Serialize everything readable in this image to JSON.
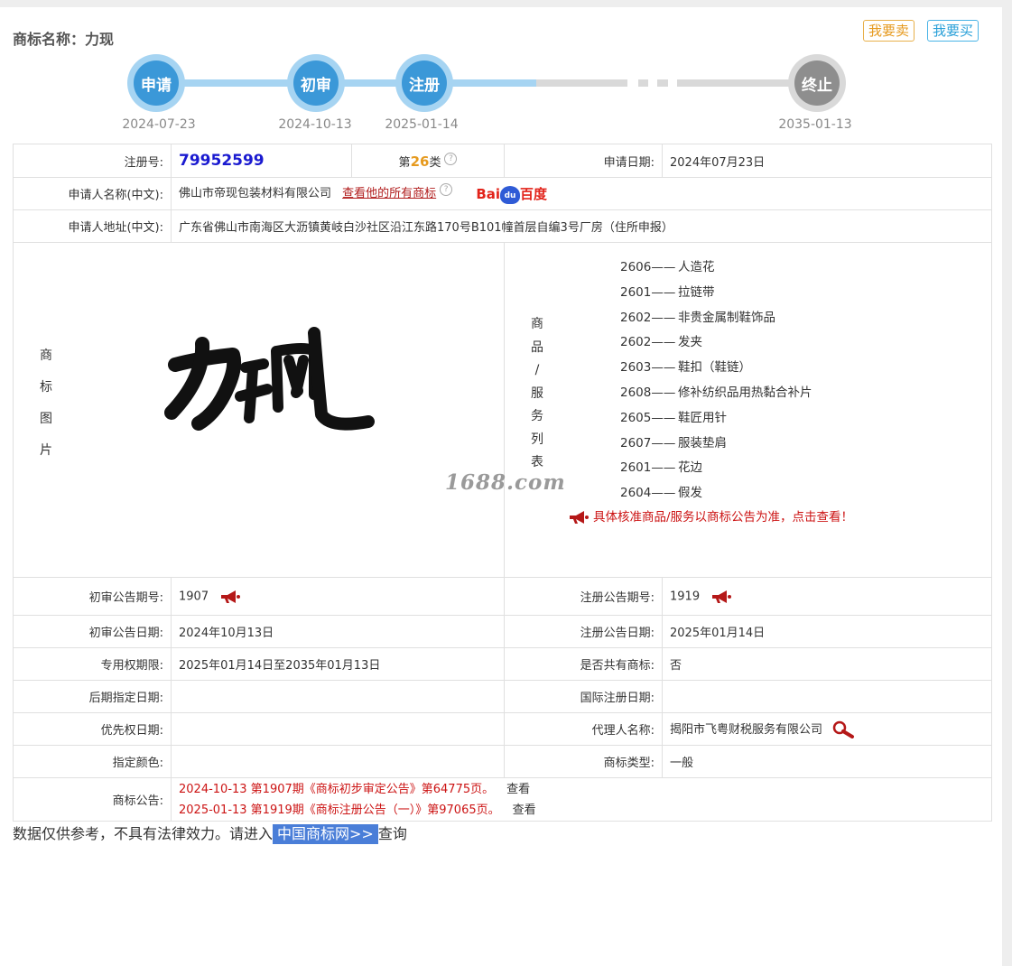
{
  "header": {
    "trademark_name": "商标名称：力现",
    "sell_button": "我要卖",
    "buy_button": "我要买"
  },
  "timeline": {
    "steps": [
      {
        "label": "申请",
        "date": "2024-07-23"
      },
      {
        "label": "初审",
        "date": "2024-10-13"
      },
      {
        "label": "注册",
        "date": "2025-01-14"
      },
      {
        "label": "终止",
        "date": "2035-01-13"
      }
    ]
  },
  "info": {
    "reg_no_label": "注册号:",
    "reg_no": "79952599",
    "class_prefix": "第",
    "class_num": "26",
    "class_suffix": "类",
    "apply_date_label": "申请日期:",
    "apply_date": "2024年07月23日",
    "applicant_label": "申请人名称(中文):",
    "applicant": "佛山市帝现包装材料有限公司",
    "view_all_link": "查看他的所有商标",
    "baidu_a": "Bai",
    "baidu_paw": "du",
    "baidu_b": "百度",
    "address_label": "申请人地址(中文):",
    "address": "广东省佛山市南海区大沥镇黄岐白沙社区沿江东路170号B101幢首层自编3号厂房（住所申报）",
    "image_label_chars": [
      "商",
      "标",
      "图",
      "片"
    ],
    "watermark": "1688.com",
    "goods_label_chars": [
      "商",
      "品",
      "/",
      "服",
      "务",
      "列",
      "表"
    ],
    "goods": [
      {
        "code": "2606——",
        "name": "人造花"
      },
      {
        "code": "2601——",
        "name": "拉链带"
      },
      {
        "code": "2602——",
        "name": "非贵金属制鞋饰品"
      },
      {
        "code": "2602——",
        "name": "发夹"
      },
      {
        "code": "2603——",
        "name": "鞋扣（鞋链）"
      },
      {
        "code": "2608——",
        "name": "修补纺织品用热黏合补片"
      },
      {
        "code": "2605——",
        "name": "鞋匠用针"
      },
      {
        "code": "2607——",
        "name": "服装垫肩"
      },
      {
        "code": "2601——",
        "name": "花边"
      },
      {
        "code": "2604——",
        "name": "假发"
      }
    ],
    "goods_note": "具体核准商品/服务以商标公告为准，点击查看！",
    "prelim_pub_no_label": "初审公告期号:",
    "prelim_pub_no": "1907",
    "reg_pub_no_label": "注册公告期号:",
    "reg_pub_no": "1919",
    "prelim_pub_date_label": "初审公告日期:",
    "prelim_pub_date": "2024年10月13日",
    "reg_pub_date_label": "注册公告日期:",
    "reg_pub_date": "2025年01月14日",
    "exclusive_label": "专用权期限:",
    "exclusive": "2025年01月14日至2035年01月13日",
    "shared_label": "是否共有商标:",
    "shared": "否",
    "later_date_label": "后期指定日期:",
    "later_date": "",
    "intl_date_label": "国际注册日期:",
    "intl_date": "",
    "priority_label": "优先权日期:",
    "priority": "",
    "agent_label": "代理人名称:",
    "agent": "揭阳市飞粤财税服务有限公司",
    "color_label": "指定颜色:",
    "color": "",
    "type_label": "商标类型:",
    "type": "一般",
    "notice_label": "商标公告:",
    "notices": [
      {
        "text": "2024-10-13 第1907期《商标初步审定公告》第64775页。",
        "view": "查看"
      },
      {
        "text": "2025-01-13 第1919期《商标注册公告（一）》第97065页。",
        "view": "查看"
      }
    ]
  },
  "footer": {
    "text_before": "数据仅供参考，不具有法律效力。请进入",
    "link": "中国商标网>>",
    "text_after": "查询"
  },
  "colors": {
    "accent_blue": "#3b98d8",
    "light_blue": "#a6d4f2",
    "red": "#cc1414",
    "orange": "#e69a1f"
  }
}
